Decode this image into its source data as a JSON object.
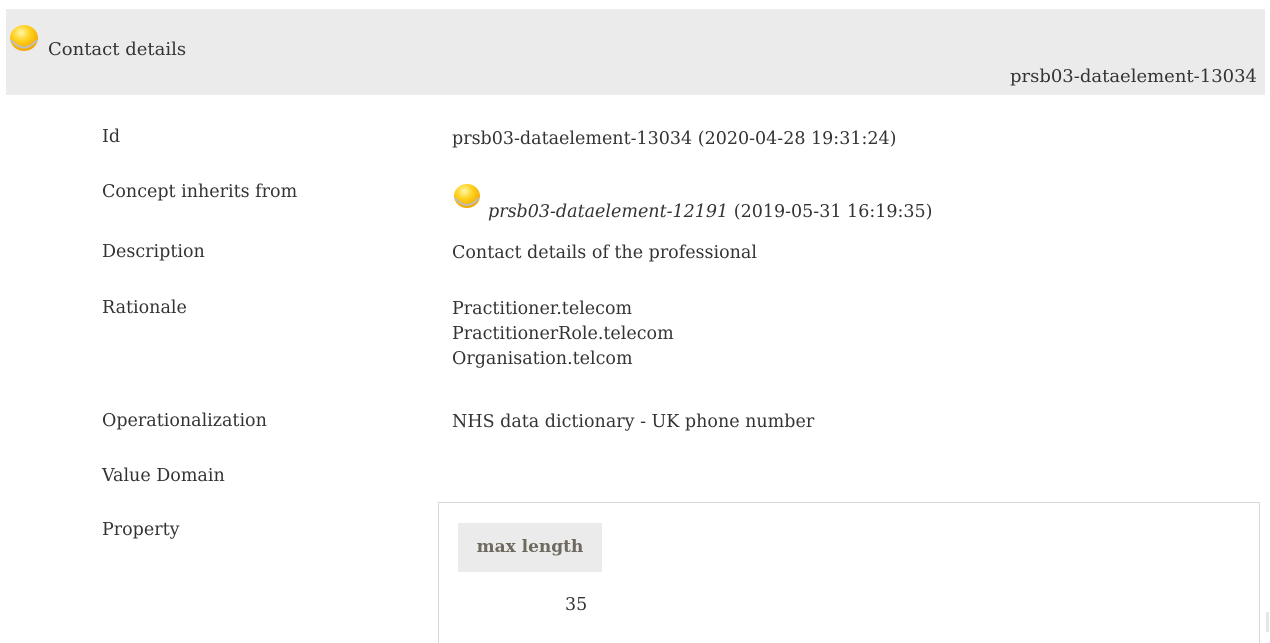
{
  "header": {
    "title": "Contact details",
    "id": "prsb03-dataelement-13034"
  },
  "details": {
    "id": {
      "label": "Id",
      "value": "prsb03-dataelement-13034 (2020-04-28 19:31:24)"
    },
    "inherits": {
      "label": "Concept inherits from",
      "link": "prsb03-dataelement-12191",
      "date": "(2019-05-31 16:19:35)"
    },
    "description": {
      "label": "Description",
      "value": "Contact details of the professional"
    },
    "rationale": {
      "label": "Rationale",
      "lines": [
        "Practitioner.telecom",
        "PractitionerRole.telecom",
        "Organisation.telcom"
      ]
    },
    "operationalization": {
      "label": "Operationalization",
      "value": "NHS data dictionary - UK phone number"
    },
    "value_domain": {
      "label": "Value Domain"
    },
    "property": {
      "label": "Property",
      "header": "max length",
      "value": "35"
    }
  },
  "colors": {
    "header_bg": "#ebebeb",
    "status_dot": "#f5b400",
    "property_header_text": "#6f6a5e"
  },
  "icons": {
    "status": "yellow-status-dot-icon"
  }
}
